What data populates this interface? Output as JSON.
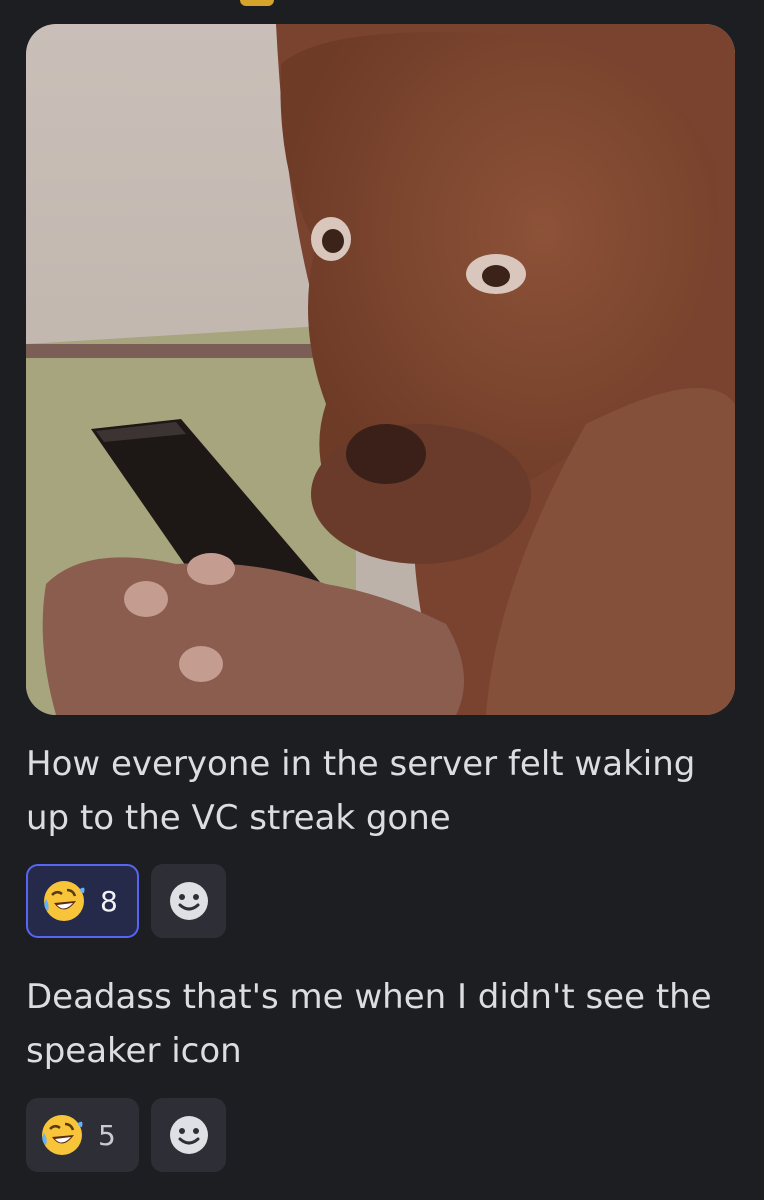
{
  "messages": [
    {
      "text": "How everyone in the server felt waking up to the VC streak gone",
      "reaction": {
        "emoji": "rolling-on-the-floor-laughing-emoji",
        "count": "8",
        "reacted_by_me": true
      },
      "add_reaction_icon": "smiley-add-reaction-icon"
    },
    {
      "text": "Deadass that's me when I didn't see the speaker icon",
      "reaction": {
        "emoji": "rolling-on-the-floor-laughing-emoji",
        "count": "5",
        "reacted_by_me": false
      },
      "add_reaction_icon": "smiley-add-reaction-icon"
    }
  ],
  "image": {
    "description_icon": "dog-holding-phone-meme-image"
  },
  "colors": {
    "background": "#1d1e22",
    "text": "#dcdde1",
    "reaction_bg": "#2e2f36",
    "reaction_active_border": "#5865f2",
    "reaction_active_bg": "#262a4a"
  }
}
